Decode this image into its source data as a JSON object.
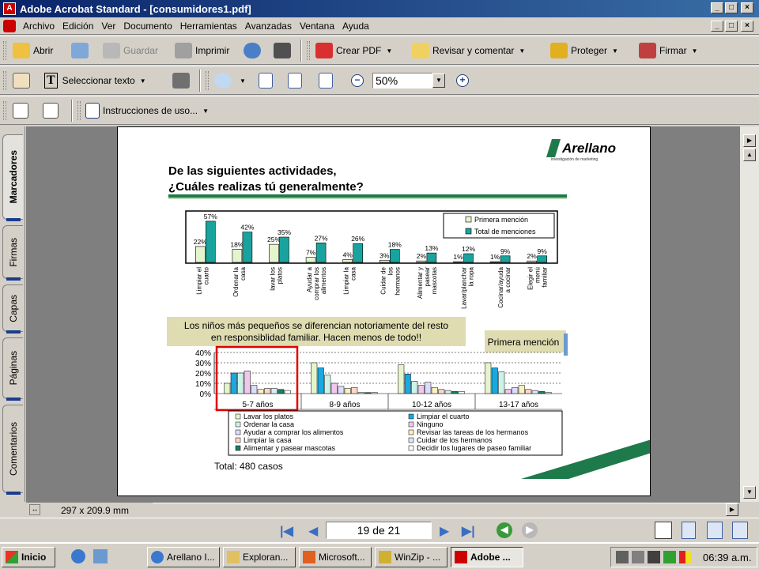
{
  "window": {
    "title": "Adobe Acrobat Standard - [consumidores1.pdf]"
  },
  "menu": [
    "Archivo",
    "Edición",
    "Ver",
    "Documento",
    "Herramientas",
    "Avanzadas",
    "Ventana",
    "Ayuda"
  ],
  "toolbar1": {
    "open": "Abrir",
    "save": "Guardar",
    "print": "Imprimir",
    "create_pdf": "Crear PDF",
    "review": "Revisar y comentar",
    "protect": "Proteger",
    "sign": "Firmar"
  },
  "toolbar2": {
    "select_text": "Seleccionar texto",
    "zoom": "50%"
  },
  "toolbar3": {
    "instructions": "Instrucciones de uso..."
  },
  "side_tabs": [
    "Marcadores",
    "Firmas",
    "Capas",
    "Páginas",
    "Comentarios"
  ],
  "status": {
    "page_size": "297 x 209.9 mm"
  },
  "nav": {
    "page_indicator": "19 de 21"
  },
  "taskbar": {
    "start": "Inicio",
    "tasks": [
      "Arellano I...",
      "Exploran...",
      "Microsoft...",
      "WinZip - ...",
      "Adobe ..."
    ],
    "clock": "06:39 a.m."
  },
  "slide": {
    "logo": "Arellano",
    "logo_sub": "investigación de marketing",
    "title_line1": "De las siguientes actividades,",
    "title_line2": "¿Cuáles realizas tú generalmente?",
    "callout_line1": "Los niños más pequeños se diferencian notoriamente del resto",
    "callout_line2": "en responsiblidad familiar. Hacen menos de todo!!",
    "primera_box": "Primera mención",
    "total": "Total: 480 casos"
  },
  "chart_data": [
    {
      "type": "bar",
      "categories": [
        "Limpiar el cuarto",
        "Ordenar la casa",
        "lavar los platos",
        "Ayudar a comprar los alimentos",
        "Limpiar la casa",
        "Cuidar de los hermanos",
        "Alimentar y pasear mascotas",
        "Lavar/planchar la ropa",
        "Cocinar/ayuda a cocinar",
        "Elegir el menú familiar"
      ],
      "series": [
        {
          "name": "Primera mención",
          "values": [
            22,
            18,
            25,
            7,
            4,
            3,
            2,
            1,
            1,
            2
          ],
          "color": "#e4f4cc"
        },
        {
          "name": "Total de menciones",
          "values": [
            57,
            42,
            35,
            27,
            26,
            18,
            13,
            12,
            9,
            9
          ],
          "color": "#1aa39e"
        }
      ],
      "value_labels": {
        "Primera mención": [
          "22%",
          "18%",
          "25%",
          "7%",
          "4%",
          "3%",
          "2%",
          "1%",
          "1%",
          "2%"
        ],
        "Total de menciones": [
          "57%",
          "42%",
          "35%",
          "27%",
          "26%",
          "18%",
          "13%",
          "12%",
          "9%",
          "9%"
        ]
      },
      "ylim": [
        0,
        70
      ]
    },
    {
      "type": "bar",
      "categories": [
        "5-7 años",
        "8-9 años",
        "10-12 años",
        "13-17 años"
      ],
      "yticks": [
        "40%",
        "30%",
        "20%",
        "10%",
        "0%"
      ],
      "ylim": [
        0,
        40
      ],
      "series": [
        {
          "name": "Lavar los platos",
          "color": "#e4f4cc",
          "values": [
            10,
            30,
            28,
            30
          ]
        },
        {
          "name": "Limpiar el cuarto",
          "color": "#19a9e0",
          "values": [
            20,
            25,
            19,
            25
          ]
        },
        {
          "name": "Ordenar la casa",
          "color": "#ccf4e6",
          "values": [
            20,
            18,
            12,
            21
          ]
        },
        {
          "name": "Ninguno",
          "color": "#f0c8ee",
          "values": [
            22,
            10,
            8,
            4
          ]
        },
        {
          "name": "Ayudar a comprar los alimentos",
          "color": "#dcdcfc",
          "values": [
            8,
            7,
            11,
            6
          ]
        },
        {
          "name": "Revisar las tareas de los hermanos",
          "color": "#fcf0c0",
          "values": [
            4,
            5,
            6,
            8
          ]
        },
        {
          "name": "Limpiar la casa",
          "color": "#fcd8c8",
          "values": [
            5,
            6,
            4,
            4
          ]
        },
        {
          "name": "Cuidar de los hermanos",
          "color": "#dceaf4",
          "values": [
            5,
            1,
            3,
            3
          ]
        },
        {
          "name": "Alimentar y pasear mascotas",
          "color": "#1a8060",
          "values": [
            4,
            1,
            2,
            2
          ]
        },
        {
          "name": "Decidir los lugares de paseo familiar",
          "color": "#ffffff",
          "values": [
            3,
            1,
            2,
            1
          ]
        }
      ]
    }
  ]
}
